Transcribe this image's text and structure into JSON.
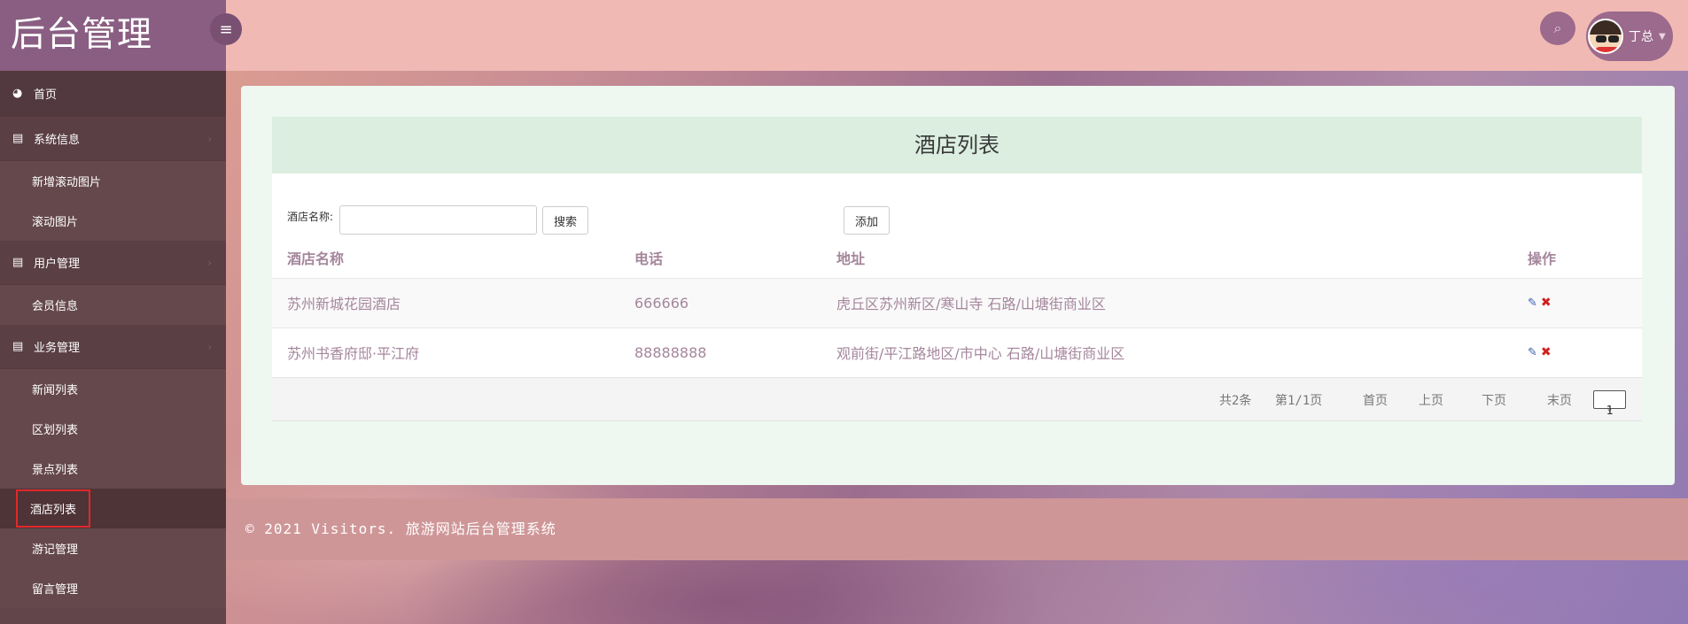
{
  "brand": {
    "title": "后台管理"
  },
  "icons": {
    "toggle": "menu-icon",
    "search": "search-icon",
    "dashboard": "dashboard-icon",
    "book": "book-icon",
    "edit": "pencil-icon",
    "delete": "x-icon"
  },
  "sidebar": {
    "home": "首页",
    "groups": [
      {
        "label": "系统信息",
        "items": [
          "新增滚动图片",
          "滚动图片"
        ]
      },
      {
        "label": "用户管理",
        "items": [
          "会员信息"
        ]
      },
      {
        "label": "业务管理",
        "items": [
          "新闻列表",
          "区划列表",
          "景点列表",
          "酒店列表",
          "游记管理",
          "留言管理"
        ]
      }
    ],
    "active_item": "酒店列表"
  },
  "topbar": {
    "user_name": "丁总"
  },
  "page": {
    "title": "酒店列表",
    "search_label": "酒店名称:",
    "search_value": "",
    "search_button": "搜索",
    "add_button": "添加"
  },
  "table": {
    "headers": [
      "酒店名称",
      "电话",
      "地址",
      "操作"
    ],
    "rows": [
      {
        "name": "苏州新城花园酒店",
        "tel": "666666",
        "addr": "虎丘区苏州新区/寒山寺 石路/山塘街商业区"
      },
      {
        "name": "苏州书香府邸·平江府",
        "tel": "88888888",
        "addr": "观前街/平江路地区/市中心 石路/山塘街商业区"
      }
    ]
  },
  "pager": {
    "total": "共2条",
    "current": "第1/1页",
    "first": "首页",
    "prev": "上页",
    "next": "下页",
    "last": "末页",
    "select_value": "1"
  },
  "footer": {
    "text": "© 2021 Visitors. 旅游网站后台管理系统"
  }
}
